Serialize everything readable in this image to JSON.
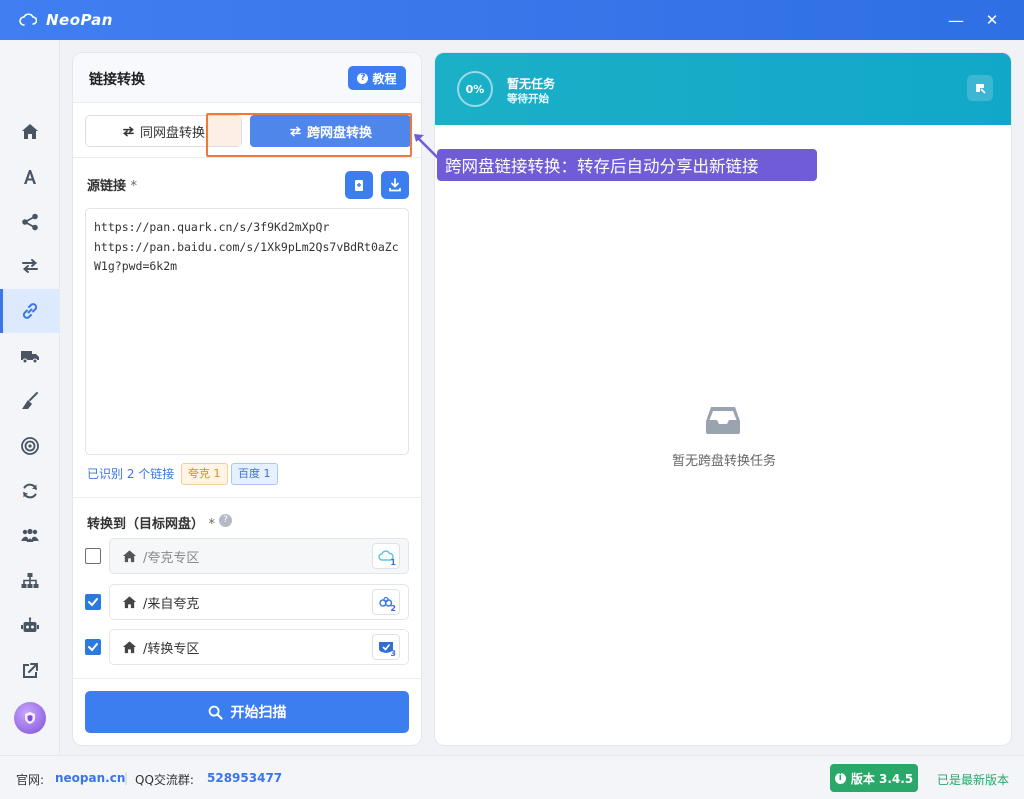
{
  "app": {
    "name": "NeoPan"
  },
  "window": {
    "minimize_label": "—",
    "close_label": "✕"
  },
  "sidebar": {
    "items": [
      {
        "name": "home-icon"
      },
      {
        "name": "font-icon"
      },
      {
        "name": "share-icon"
      },
      {
        "name": "transfer-icon"
      },
      {
        "name": "link-icon",
        "active": true
      },
      {
        "name": "truck-icon"
      },
      {
        "name": "broom-icon"
      },
      {
        "name": "target-icon"
      },
      {
        "name": "sync-icon"
      },
      {
        "name": "users-icon"
      },
      {
        "name": "sitemap-icon"
      },
      {
        "name": "robot-icon"
      },
      {
        "name": "external-link-icon"
      }
    ]
  },
  "left_panel": {
    "title": "链接转换",
    "tutorial_label": "教程",
    "mode_same_label": "同网盘转换",
    "mode_cross_label": "跨网盘转换",
    "source_label": "源链接",
    "required_mark": "*",
    "source_text": "https://pan.quark.cn/s/3f9Kd2mXpQr\nhttps://pan.baidu.com/s/1Xk9pLm2Qs7vBdRt0aZcW1g?pwd=6k2m",
    "recognized_text": "已识别 2 个链接",
    "tags": {
      "quark": "夸克 1",
      "baidu": "百度 1"
    },
    "target_label": "转换到（目标网盘）",
    "targets": [
      {
        "path": "/夸克专区",
        "checked": false,
        "drive_number": "1",
        "disabled": true
      },
      {
        "path": "/来自夸克",
        "checked": true,
        "drive_number": "2",
        "disabled": false
      },
      {
        "path": "/转换专区",
        "checked": true,
        "drive_number": "3",
        "disabled": false
      }
    ],
    "start_label": "开始扫描"
  },
  "right_panel": {
    "progress_percent": "0%",
    "progress_value": 0,
    "task_title": "暂无任务",
    "task_sub": "等待开始",
    "empty_text": "暂无跨盘转换任务"
  },
  "callout": {
    "text": "跨网盘链接转换：转存后自动分享出新链接"
  },
  "footer": {
    "site_label": "官网:",
    "site_link": "neopan.cn",
    "qq_label": "QQ交流群:",
    "qq_number": "528953477",
    "version_label": "版本 3.4.5",
    "latest_label": "已是最新版本"
  },
  "colors": {
    "accent": "#3c7ef0",
    "teal_header": "#1bb0c7",
    "callout": "#6f5cd6",
    "highlight_border": "#ee7a3a",
    "success": "#2aa86a"
  }
}
